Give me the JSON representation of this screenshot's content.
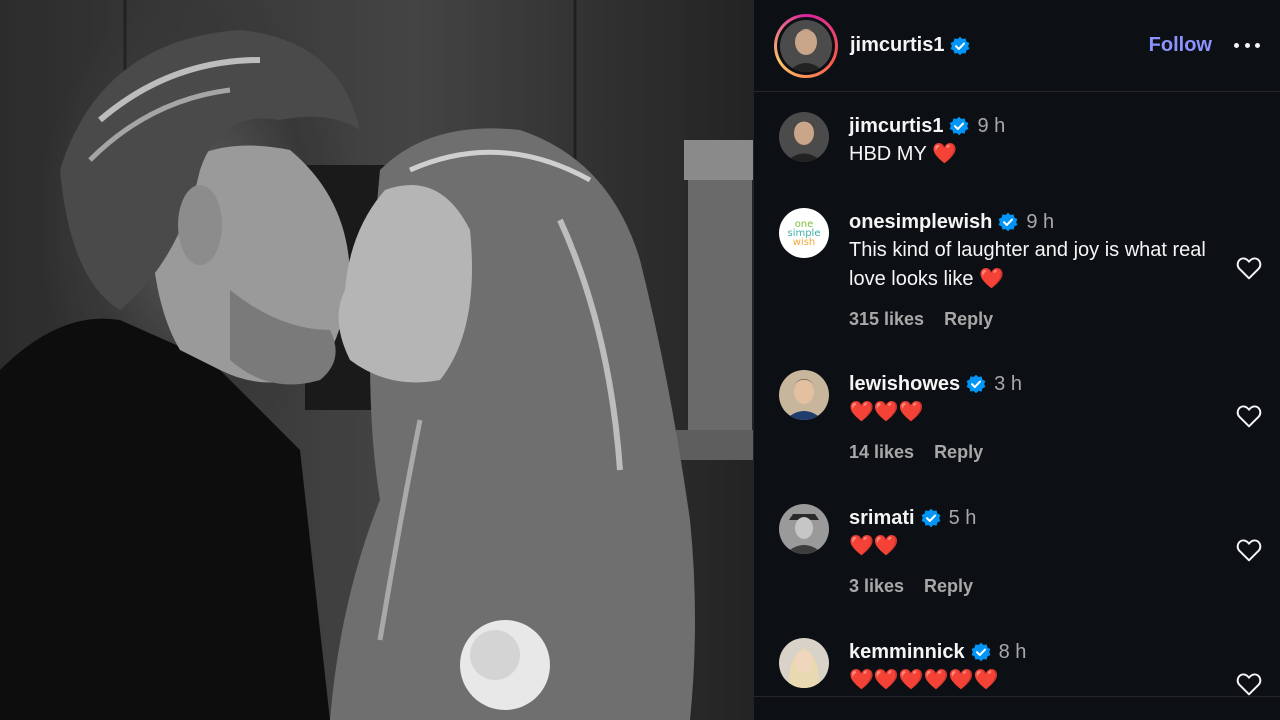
{
  "post": {
    "author": "jimcurtis1",
    "follow_label": "Follow"
  },
  "comments": [
    {
      "user": "jimcurtis1",
      "time": "9 h",
      "text": "HBD MY ❤️",
      "likes": "",
      "reply": ""
    },
    {
      "user": "onesimplewish",
      "time": "9 h",
      "text": "This kind of laughter and joy is what real love looks like ❤️",
      "likes": "315 likes",
      "reply": "Reply"
    },
    {
      "user": "lewishowes",
      "time": "3 h",
      "text": "❤️❤️❤️",
      "likes": "14 likes",
      "reply": "Reply"
    },
    {
      "user": "srimati",
      "time": "5 h",
      "text": "❤️❤️",
      "likes": "3 likes",
      "reply": "Reply"
    },
    {
      "user": "kemminnick",
      "time": "8 h",
      "text": "❤️❤️❤️❤️❤️❤️",
      "likes": "",
      "reply": ""
    }
  ],
  "avatar_logo_text": [
    "one",
    "simple",
    "wish"
  ],
  "colors": {
    "panel_bg": "#0c1014",
    "follow_blue": "#8b93ff",
    "verified_blue": "#0095f6",
    "muted_text": "#a8a8a8"
  },
  "icons": {
    "verified": "verified-badge-icon",
    "more": "more-horizontal-icon",
    "like": "heart-outline-icon"
  }
}
